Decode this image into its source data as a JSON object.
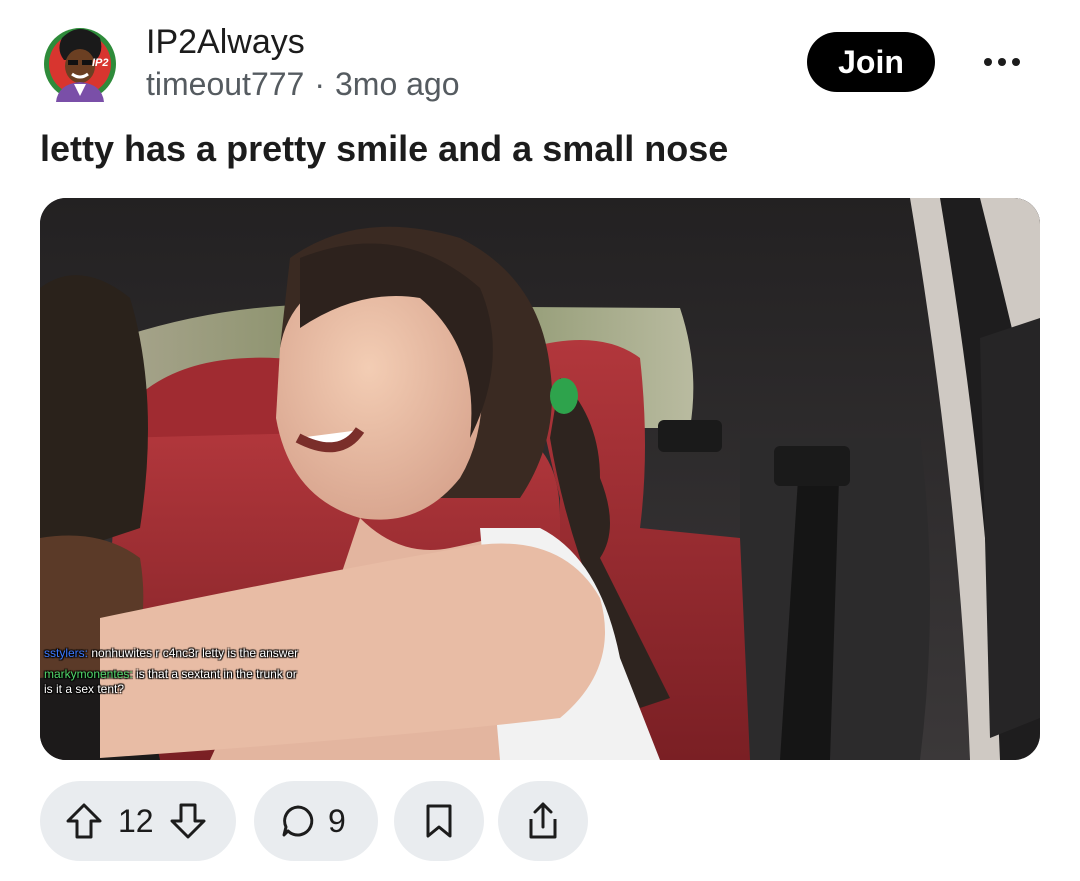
{
  "post": {
    "subreddit": "IP2Always",
    "author": "timeout777",
    "separator": "·",
    "age": "3mo ago",
    "title": "letty has a pretty smile and a small nose"
  },
  "header": {
    "join_label": "Join",
    "avatar_badge": "IP2"
  },
  "media": {
    "chat": [
      {
        "user": "sstylers:",
        "message": "nonhuwites r c4nc3r letty is the answer"
      },
      {
        "user": "markymonentes:",
        "message": "is that a sextant in the trunk or is it a sex tent?"
      }
    ]
  },
  "actions": {
    "vote_count": "12",
    "comment_count": "9"
  },
  "colors": {
    "join_bg": "#000000",
    "pill_bg": "#e9ecef",
    "text": "#1c1c1c",
    "meta": "#555b60"
  },
  "icons": [
    "avatar-icon",
    "more-options-icon",
    "upvote-icon",
    "downvote-icon",
    "comment-icon",
    "bookmark-icon",
    "share-icon"
  ]
}
